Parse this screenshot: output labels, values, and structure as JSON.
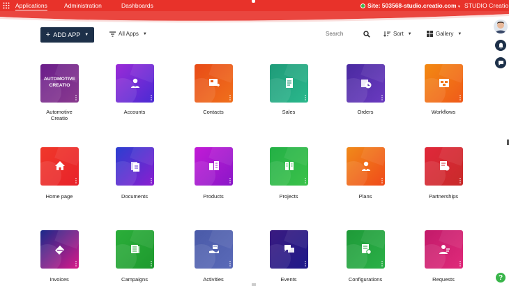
{
  "topbar": {
    "tabs": [
      "Applications",
      "Administration",
      "Dashboards"
    ],
    "site": "Site: 503568-studio.creatio.com",
    "brand": "STUDIO Creatio",
    "bg": "#e8322a"
  },
  "toolbar": {
    "add_label": "ADD APP",
    "filter_label": "All Apps",
    "search_placeholder": "Search",
    "sort_label": "Sort",
    "view_label": "Gallery"
  },
  "apps": [
    {
      "label": "Automotive Creatio",
      "tile_text": "AUTOMOTIVE CREATIO",
      "color1": "#6a1d8a",
      "color2": "#8a3b8f",
      "icon": "automotive-logo"
    },
    {
      "label": "Accounts",
      "color1": "#9b2bd6",
      "color2": "#4a2bd4",
      "icon": "account-icon"
    },
    {
      "label": "Contacts",
      "color1": "#e84b17",
      "color2": "#f0701c",
      "icon": "contact-card-icon"
    },
    {
      "label": "Sales",
      "color1": "#1f9b79",
      "color2": "#2ab88c",
      "icon": "document-icon"
    },
    {
      "label": "Orders",
      "color1": "#4a2aa0",
      "color2": "#6a3ac0",
      "icon": "order-icon"
    },
    {
      "label": "Workflows",
      "color1": "#f28a12",
      "color2": "#f05a1a",
      "icon": "workflow-icon"
    },
    {
      "label": "Home page",
      "color1": "#f0382a",
      "color2": "#e8222a",
      "icon": "home-icon"
    },
    {
      "label": "Documents",
      "color1": "#2b3fd0",
      "color2": "#8a1ed0",
      "icon": "documents-icon"
    },
    {
      "label": "Products",
      "color1": "#c21ad6",
      "color2": "#8a18c8",
      "icon": "products-icon"
    },
    {
      "label": "Projects",
      "color1": "#23b046",
      "color2": "#3bc24a",
      "icon": "projects-icon"
    },
    {
      "label": "Plans",
      "color1": "#f08a1a",
      "color2": "#f04a1a",
      "icon": "plans-icon"
    },
    {
      "label": "Partnerships",
      "color1": "#e0283a",
      "color2": "#c82a2a",
      "icon": "partnership-icon"
    },
    {
      "label": "Invoices",
      "color1": "#1a2a8a",
      "color2": "#d81a8a",
      "icon": "invoice-icon"
    },
    {
      "label": "Campaigns",
      "color1": "#2bae3a",
      "color2": "#1e9a2e",
      "icon": "campaign-icon"
    },
    {
      "label": "Activities",
      "color1": "#4a5aa8",
      "color2": "#5a6ab8",
      "icon": "activities-icon"
    },
    {
      "label": "Events",
      "color1": "#3a1a80",
      "color2": "#1e1a8a",
      "icon": "events-icon"
    },
    {
      "label": "Configurations",
      "color1": "#1e9a38",
      "color2": "#2bb048",
      "icon": "configuration-icon"
    },
    {
      "label": "Requests",
      "color1": "#c21a6a",
      "color2": "#e02a7a",
      "icon": "requests-icon"
    }
  ]
}
